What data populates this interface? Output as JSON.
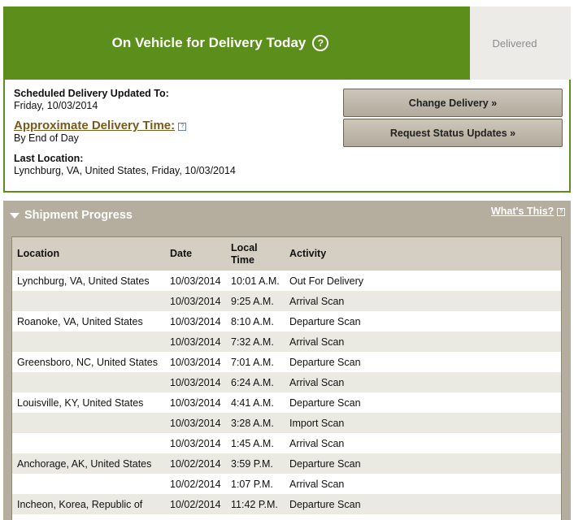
{
  "status": {
    "current": "On Vehicle for Delivery Today",
    "next": "Delivered"
  },
  "delivery": {
    "scheduled_label": "Scheduled Delivery Updated To:",
    "scheduled_value": "Friday, 10/03/2014",
    "approx_label": "Approximate Delivery Time:",
    "approx_value": "By End of Day",
    "last_location_label": "Last Location:",
    "last_location_value": "Lynchburg, VA, United States, Friday, 10/03/2014"
  },
  "buttons": {
    "change_delivery": "Change Delivery »",
    "request_updates": "Request Status Updates »"
  },
  "progress": {
    "title": "Shipment Progress",
    "whats_this": "What's This?",
    "columns": [
      "Location",
      "Date",
      "Local Time",
      "Activity"
    ],
    "rows": [
      {
        "location": "Lynchburg, VA, United States",
        "date": "10/03/2014",
        "time": "10:01 A.M.",
        "activity": "Out For Delivery"
      },
      {
        "location": "",
        "date": "10/03/2014",
        "time": "9:25 A.M.",
        "activity": "Arrival Scan"
      },
      {
        "location": "Roanoke, VA, United States",
        "date": "10/03/2014",
        "time": "8:10 A.M.",
        "activity": "Departure Scan"
      },
      {
        "location": "",
        "date": "10/03/2014",
        "time": "7:32 A.M.",
        "activity": "Arrival Scan"
      },
      {
        "location": "Greensboro, NC, United States",
        "date": "10/03/2014",
        "time": "7:01 A.M.",
        "activity": "Departure Scan"
      },
      {
        "location": "",
        "date": "10/03/2014",
        "time": "6:24 A.M.",
        "activity": "Arrival Scan"
      },
      {
        "location": "Louisville, KY, United States",
        "date": "10/03/2014",
        "time": "4:41 A.M.",
        "activity": "Departure Scan"
      },
      {
        "location": "",
        "date": "10/03/2014",
        "time": "3:28 A.M.",
        "activity": "Import Scan"
      },
      {
        "location": "",
        "date": "10/03/2014",
        "time": "1:45 A.M.",
        "activity": "Arrival Scan"
      },
      {
        "location": "Anchorage, AK, United States",
        "date": "10/02/2014",
        "time": "3:59 P.M.",
        "activity": "Departure Scan"
      },
      {
        "location": "",
        "date": "10/02/2014",
        "time": "1:07 P.M.",
        "activity": "Arrival Scan"
      },
      {
        "location": "Incheon, Korea, Republic of",
        "date": "10/02/2014",
        "time": "11:42 P.M.",
        "activity": "Departure Scan"
      }
    ]
  }
}
